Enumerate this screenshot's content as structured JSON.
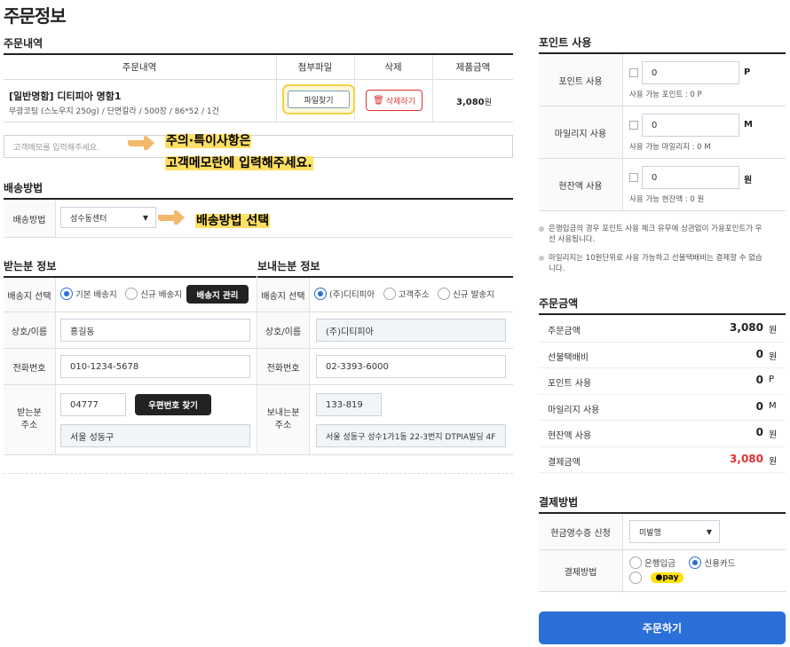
{
  "page_title": "주문정보",
  "order": {
    "section_title": "주문내역",
    "columns": [
      "주문내역",
      "첨부파일",
      "삭제",
      "제품금액"
    ],
    "item_name": "[일반명함] 디티피아 명함1",
    "item_desc": "무광코팅 (스노우지 250g) / 단면칼라 / 500장 / 86*52 / 1건",
    "attach_label": "파일찾기",
    "delete_label": "삭제하기",
    "price": "3,080",
    "price_unit": "원",
    "memo_placeholder": "고객메모를 입력해주세요.",
    "callout_line1": "주의·특이사항은",
    "callout_line2": "고객메모란에 입력해주세요."
  },
  "shipping": {
    "section_title": "배송방법",
    "label": "배송방법",
    "selected": "성수동센터",
    "callout": "배송방법 선택"
  },
  "receiver": {
    "section_title": "받는분 정보",
    "dest_label": "배송지 선택",
    "options": [
      "기본 배송지",
      "신규 배송지"
    ],
    "manage_label": "배송지 관리",
    "name_label": "상호/이름",
    "name_value": "홍길동",
    "phone_label": "전화번호",
    "phone_value": "010-1234-5678",
    "addr_label_1": "받는분",
    "addr_label_2": "주소",
    "zip": "04777",
    "zip_btn": "우편번호 찾기",
    "addr": "서울 성동구"
  },
  "sender": {
    "section_title": "보내는분 정보",
    "dest_label": "배송지 선택",
    "options": [
      "(주)디티피아",
      "고객주소",
      "신규 발송지"
    ],
    "name_label": "상호/이름",
    "name_value": "(주)디티피아",
    "phone_label": "전화번호",
    "phone_value": "02-3393-6000",
    "addr_label_1": "보내는분",
    "addr_label_2": "주소",
    "zip": "133-819",
    "addr": "서울 성동구 성수1가1동 22-3번지 DTPIA빌딩 4F"
  },
  "points": {
    "section_title": "포인트 사용",
    "rows": [
      {
        "label": "포인트 사용",
        "value": "0",
        "unit": "P",
        "hint": "사용 가능 포인트 : 0 P"
      },
      {
        "label": "마일리지 사용",
        "value": "0",
        "unit": "M",
        "hint": "사용 가능 마일리지 : 0 M"
      },
      {
        "label": "현잔액 사용",
        "value": "0",
        "unit": "원",
        "hint": "사용 가능 현잔액 : 0 원"
      }
    ],
    "note1_a": "은행입금의 경우 포인트 사용 체크 유무에 상관없이 가용포인트가 우",
    "note1_b": "선 사용됩니다.",
    "note2_a": "마일리지는 10원단위로 사용 가능하고 선불택배비는 결제할 수 없습",
    "note2_b": "니다."
  },
  "summary": {
    "section_title": "주문금액",
    "rows": [
      {
        "label": "주문금액",
        "value": "3,080",
        "unit": "원"
      },
      {
        "label": "선불택배비",
        "value": "0",
        "unit": "원"
      },
      {
        "label": "포인트 사용",
        "value": "0",
        "unit": "P"
      },
      {
        "label": "마일리지 사용",
        "value": "0",
        "unit": "M"
      },
      {
        "label": "현잔액 사용",
        "value": "0",
        "unit": "원"
      },
      {
        "label": "결제금액",
        "value": "3,080",
        "unit": "원"
      }
    ],
    "total_color": "#e03131"
  },
  "payment": {
    "section_title": "결제방법",
    "receipt_label": "현금영수증 신청",
    "receipt_value": "미발행",
    "method_label": "결제방법",
    "options": [
      "은행입금",
      "신용카드"
    ],
    "pay_label": "pay",
    "submit": "주문하기"
  },
  "colors": {
    "accent": "#2b6fd8",
    "highlight": "#ffe066",
    "danger": "#e03131"
  }
}
